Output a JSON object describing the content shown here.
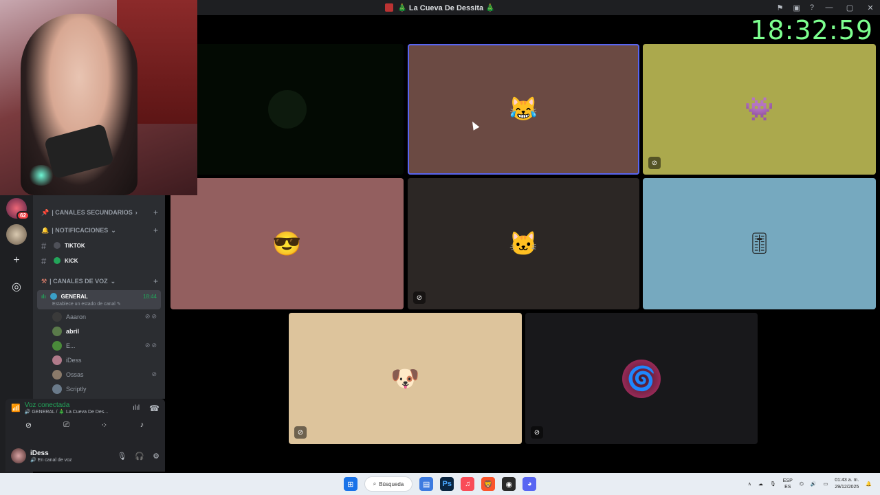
{
  "window": {
    "title": "🎄 La Cueva De Dessita 🎄",
    "controls": [
      "—",
      "▢",
      "✕"
    ]
  },
  "clock": "18:32:59",
  "rail": {
    "server_badge": "62"
  },
  "sidebar": {
    "categories": {
      "secondary": "| CANALES SECUNDARIOS",
      "notifications": "| NOTIFICACIONES",
      "voice": "| CANALES DE VOZ"
    },
    "channels": [
      {
        "name": "TIKTOK",
        "dot_color": "#4e5058"
      },
      {
        "name": "KICK",
        "dot_color": "#23a55a"
      }
    ],
    "voice_channel": {
      "name": "GENERAL",
      "time": "18:44",
      "status": "Establece un estado de canal"
    },
    "users": [
      {
        "name": "Aaaron",
        "color": "#3a3a3a"
      },
      {
        "name": "abril",
        "color": "#5a7a4a"
      },
      {
        "name": "E...",
        "color": "#4a8a3a"
      },
      {
        "name": "iDess",
        "color": "#b07a8a"
      },
      {
        "name": "Ossas",
        "color": "#8a7a6a"
      },
      {
        "name": "Scriptly",
        "color": "#6a7a8a"
      }
    ]
  },
  "voice_panel": {
    "title": "Voz conectada",
    "subtitle": "🔊 GENERAL / 🎄 La Cueva De Des..."
  },
  "user_panel": {
    "name": "iDess",
    "status": "En canal de voz"
  },
  "tiles": [
    {
      "bg": "#030a03",
      "emoji": "",
      "muted": false
    },
    {
      "bg": "#6b4a43",
      "emoji": "😹",
      "muted": false
    },
    {
      "bg": "#aba94d",
      "emoji": "👾",
      "muted": true
    },
    {
      "bg": "#935f5f",
      "emoji": "😎",
      "muted": false
    },
    {
      "bg": "#2c2725",
      "emoji": "🐱",
      "muted": true
    },
    {
      "bg": "#76a9bf",
      "emoji": "🎚",
      "muted": false
    },
    {
      "bg": "#ddc49c",
      "emoji": "🐶",
      "muted": true
    },
    {
      "bg": "#18181b",
      "emoji": "🌀",
      "muted": true
    }
  ],
  "taskbar": {
    "search": "Búsqueda",
    "lang_top": "ESP",
    "lang_bottom": "ES",
    "time": "01:43 a. m.",
    "date": "29/12/2025"
  }
}
